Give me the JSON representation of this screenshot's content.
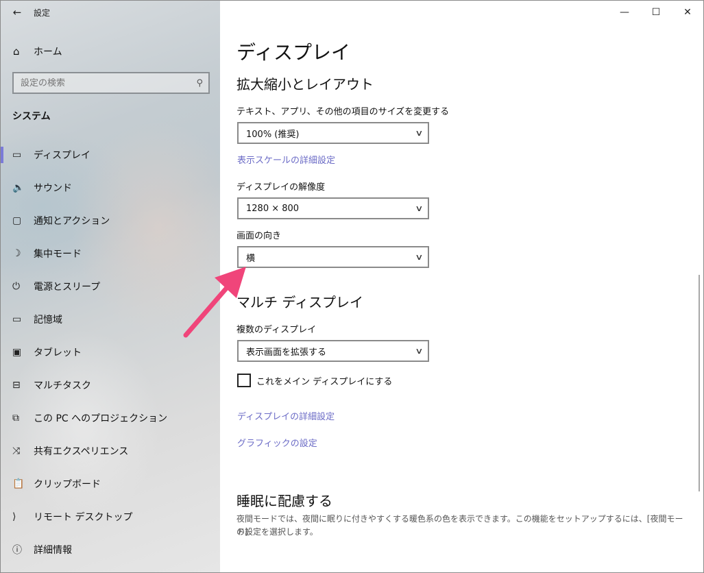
{
  "window": {
    "title": "設定",
    "back_icon": "←",
    "minimize_icon": "—",
    "maximize_icon": "☐",
    "close_icon": "✕"
  },
  "sidebar": {
    "home_label": "ホーム",
    "search_placeholder": "設定の検索",
    "section_title": "システム",
    "items": [
      {
        "label": "ディスプレイ",
        "icon": "monitor-icon",
        "glyph": "▭",
        "active": true
      },
      {
        "label": "サウンド",
        "icon": "speaker-icon",
        "glyph": "🔈"
      },
      {
        "label": "通知とアクション",
        "icon": "notification-icon",
        "glyph": "▢"
      },
      {
        "label": "集中モード",
        "icon": "moon-icon",
        "glyph": "☽"
      },
      {
        "label": "電源とスリープ",
        "icon": "power-icon",
        "glyph": "⏻"
      },
      {
        "label": "記憶域",
        "icon": "storage-icon",
        "glyph": "▭"
      },
      {
        "label": "タブレット",
        "icon": "tablet-icon",
        "glyph": "▣"
      },
      {
        "label": "マルチタスク",
        "icon": "multitask-icon",
        "glyph": "⊟"
      },
      {
        "label": "この PC へのプロジェクション",
        "icon": "projection-icon",
        "glyph": "⧉"
      },
      {
        "label": "共有エクスペリエンス",
        "icon": "share-icon",
        "glyph": "⤨"
      },
      {
        "label": "クリップボード",
        "icon": "clipboard-icon",
        "glyph": "📋"
      },
      {
        "label": "リモート デスクトップ",
        "icon": "remote-icon",
        "glyph": "⟩"
      },
      {
        "label": "詳細情報",
        "icon": "info-icon",
        "glyph": "ⓘ"
      }
    ]
  },
  "main": {
    "page_title": "ディスプレイ",
    "scale_section": {
      "heading": "拡大縮小とレイアウト",
      "scale_label": "テキスト、アプリ、その他の項目のサイズを変更する",
      "scale_value": "100% (推奨)",
      "scale_link": "表示スケールの詳細設定",
      "resolution_label": "ディスプレイの解像度",
      "resolution_value": "1280 × 800",
      "orientation_label": "画面の向き",
      "orientation_value": "横"
    },
    "multi_section": {
      "heading": "マルチ ディスプレイ",
      "multi_label": "複数のディスプレイ",
      "multi_value": "表示画面を拡張する",
      "main_display_checkbox": "これをメイン ディスプレイにする",
      "main_display_checked": false,
      "advanced_link": "ディスプレイの詳細設定",
      "graphics_link": "グラフィックの設定"
    },
    "sleep_section": {
      "heading": "睡眠に配慮する",
      "desc_line1": "夜間モードでは、夜間に眠りに付きやすくする暖色系の色を表示できます。この機能をセットアップするには、[夜間モード]",
      "desc_line2": "の設定を選択します。"
    }
  },
  "annotation": {
    "arrow_color": "#f0457a"
  }
}
